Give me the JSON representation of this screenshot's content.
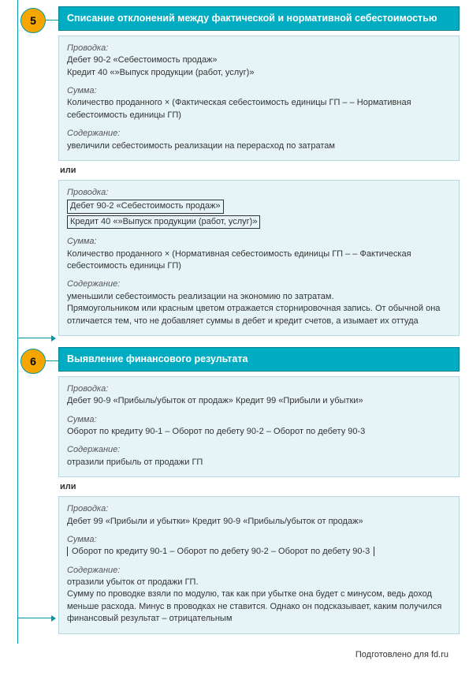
{
  "footer": "Подготовлено для fd.ru",
  "labels": {
    "entry": "Проводка:",
    "amount": "Сумма:",
    "content": "Содержание:",
    "or": "или"
  },
  "steps": [
    {
      "num": "5",
      "title": "Списание отклонений между фактической и нормативной себестоимостью",
      "blocks": [
        {
          "entry_lines": [
            "Дебет 90-2 «Себестоимость продаж»",
            "Кредит 40 «»Выпуск продукции (работ, услуг)»"
          ],
          "entry_storno": false,
          "amount": "Количество проданного × (Фактическая себестоимость единицы ГП – – Нормативная себестоимость единицы ГП)",
          "content": "увеличили себестоимость реализации на перерасход по затратам",
          "extra": ""
        },
        {
          "entry_lines": [
            "Дебет 90-2 «Себестоимость продаж»",
            "Кредит 40 «»Выпуск продукции (работ, услуг)»"
          ],
          "entry_storno": true,
          "amount": "Количество проданного × (Нормативная себестоимость единицы ГП – – Фактическая себестоимость единицы ГП)",
          "content": "уменьшили себестоимость реализации на экономию по затратам.",
          "extra": "Прямоугольником или красным цветом отражается сторнировочная запись. От обычной она отличается тем, что не добавляет суммы в дебет и кредит счетов, а изымает их оттуда"
        }
      ]
    },
    {
      "num": "6",
      "title": "Выявление финансового результата",
      "blocks": [
        {
          "entry_lines": [
            "Дебет 90-9 «Прибыль/убыток от продаж» Кредит 99 «Прибыли и убытки»"
          ],
          "entry_storno": false,
          "amount": "Оборот по кредиту 90-1 – Оборот по дебету 90-2 – Оборот по дебету 90-3",
          "amount_abs": false,
          "content": "отразили прибыль от продажи ГП",
          "extra": ""
        },
        {
          "entry_lines": [
            "Дебет 99 «Прибыли и убытки» Кредит 90-9 «Прибыль/убыток от продаж»"
          ],
          "entry_storno": false,
          "amount": "Оборот по кредиту 90-1 – Оборот по дебету 90-2 – Оборот по дебету 90-3",
          "amount_abs": true,
          "content": "отразили убыток от продажи ГП.",
          "extra": "Сумму по проводке взяли по модулю, так как при убытке она будет с минусом, ведь доход меньше расхода. Минус в проводках не ставится. Однако он подсказывает, каким получился финансовый результат – отрицательным"
        }
      ]
    }
  ]
}
